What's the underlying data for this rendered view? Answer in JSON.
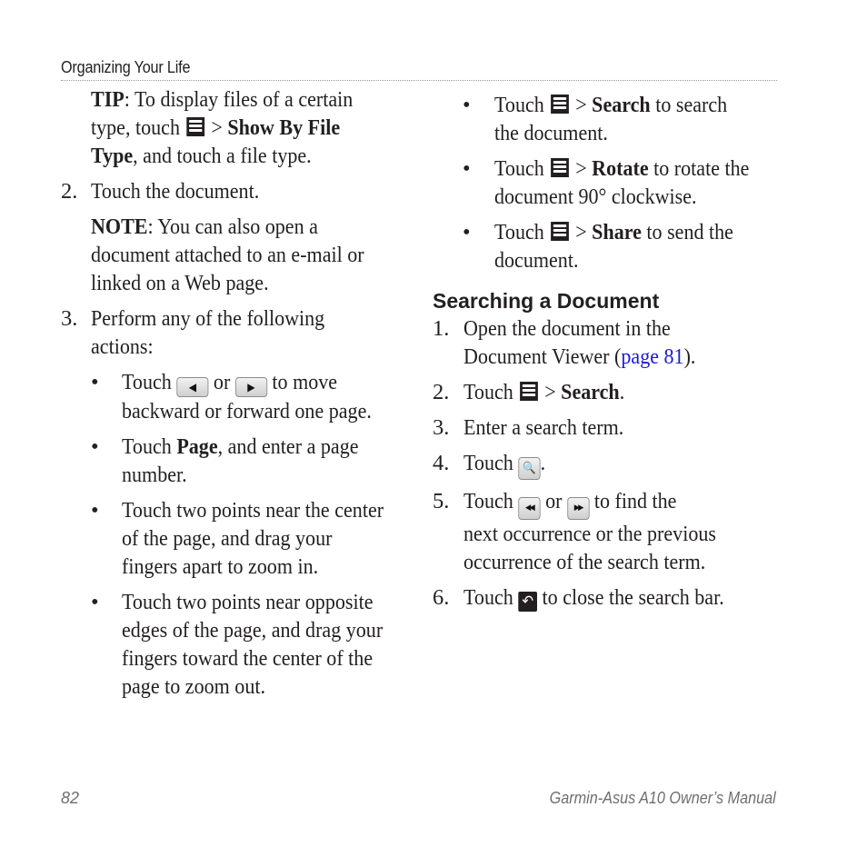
{
  "header": {
    "section_title": "Organizing Your Life"
  },
  "left_column": {
    "tip": {
      "label": "TIP",
      "text_1": ": To display files of a certain",
      "text_2": "type, touch",
      "icon": "menu-icon",
      "sep": ">",
      "bold_1": "Show By File",
      "bold_2": "Type",
      "text_3": ", and touch a file type."
    },
    "step2": {
      "number": "2.",
      "text": "Touch the document."
    },
    "note": {
      "label": "NOTE",
      "line_1": ": You can also open a",
      "line_2": "document attached to an e-mail or",
      "line_3": "linked on a Web page."
    },
    "step3": {
      "number": "3.",
      "line_1": "Perform any of the following",
      "line_2": "actions:"
    },
    "bullets": [
      {
        "marker": "•",
        "pre": "Touch",
        "icon_a": "previous-page-icon",
        "mid": "or",
        "icon_b": "next-page-icon",
        "post": "to move",
        "line_2": "backward or forward one page."
      },
      {
        "marker": "•",
        "pre": "Touch",
        "bold": "Page",
        "post": ", and enter a page",
        "line_2": "number."
      },
      {
        "marker": "•",
        "line_1": "Touch two points near the center",
        "line_2": "of the page, and drag your",
        "line_3": "fingers apart to zoom in."
      },
      {
        "marker": "•",
        "line_1": "Touch two points near opposite",
        "line_2": "edges of the page, and drag your",
        "line_3": "fingers toward the center of the",
        "line_4": "page to zoom out."
      }
    ]
  },
  "right_column": {
    "bullets": [
      {
        "marker": "•",
        "pre": "Touch",
        "icon": "menu-icon",
        "sep": ">",
        "bold": "Search",
        "post": "to search",
        "line_2": "the document."
      },
      {
        "marker": "•",
        "pre": "Touch",
        "icon": "menu-icon",
        "sep": ">",
        "bold": "Rotate",
        "post": "to rotate the",
        "line_2": "document 90° clockwise."
      },
      {
        "marker": "•",
        "pre": "Touch",
        "icon": "menu-icon",
        "sep": ">",
        "bold": "Share",
        "post": "to send the",
        "line_2": "document."
      }
    ],
    "heading": "Searching a Document",
    "steps": [
      {
        "number": "1.",
        "line_1": "Open the document in the",
        "line_2_pre": "Document Viewer (",
        "link": "page 81",
        "line_2_post": ")."
      },
      {
        "number": "2.",
        "pre": "Touch",
        "icon": "menu-icon",
        "sep": ">",
        "bold": "Search",
        "post": "."
      },
      {
        "number": "3.",
        "text": "Enter a search term."
      },
      {
        "number": "4.",
        "pre": "Touch",
        "icon": "search-icon",
        "post": "."
      },
      {
        "number": "5.",
        "pre": "Touch",
        "icon_a": "rewind-icon",
        "mid": "or",
        "icon_b": "fast-forward-icon",
        "post": "to find the",
        "line_2": "next occurrence or the previous",
        "line_3": "occurrence of the search term."
      },
      {
        "number": "6.",
        "pre": "Touch",
        "icon": "close-search-icon",
        "post": "to close the search bar."
      }
    ]
  },
  "icons": {
    "prev_glyph": "◀",
    "next_glyph": "▶",
    "rewind_glyph": "◀◀",
    "ffwd_glyph": "▶▶",
    "search_glyph": "🔍",
    "close_glyph": "↶"
  },
  "footer": {
    "page_number": "82",
    "manual_title": "Garmin-Asus A10 Owner’s Manual"
  }
}
